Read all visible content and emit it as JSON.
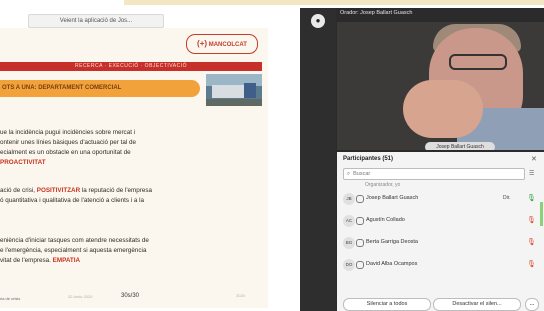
{
  "share_bar": {
    "text": "Veient la aplicació de Jos..."
  },
  "slide": {
    "logo_text": "MANCOLCAT",
    "logo_mark": "(+)",
    "red_band": "RECERCA · EXECUCIÓ · OBJECTIVACIÓ",
    "orange_band": "OTS A  UNA: DEPARTAMENT COMERCIAL",
    "p1": [
      "ue la incidència pugui incidències sobre mercat i",
      "ontenir unes línies bàsiques d'actuació per tal de",
      "ecialment es un obstacle en una oportunitat de"
    ],
    "p1_em": "PROACTIVITAT",
    "p2_a": "ació de crisi, ",
    "p2_em": "POSITIVITZAR",
    "p2_b": " la reputació de l'empresa",
    "p2_line2": "ó quantitativa i qualitativa de l'atenció a clients i a la",
    "p3": [
      "eniència d'iniciar tasques com atendre necessitats de",
      "e l'emergència, especialment si aquesta emergència"
    ],
    "p3_last_a": "vitat de l'empresa. ",
    "p3_em": "EMPATIA",
    "footer_left": "ria de crisis",
    "footer_mid": "32-iunio-2020",
    "footer_num": "30s/30",
    "footer_right": "2020"
  },
  "meeting": {
    "rail_icon": "camera-icon",
    "title": "Orador: Josep Ballart Guasch",
    "name_tag": "Josep Ballart Guasch",
    "participants_header": "Participantes (51)",
    "search_placeholder": "Buscar",
    "sub_label": "Organizador, yo",
    "rows": [
      {
        "initials": "JB",
        "name": "Josep Ballart Guasch",
        "extra": "Dir.",
        "mic": "green"
      },
      {
        "initials": "AC",
        "name": "Agustín Collado",
        "extra": "",
        "mic": "red"
      },
      {
        "initials": "BG",
        "name": "Berta Garriga Deosta",
        "extra": "",
        "mic": "red"
      },
      {
        "initials": "DO",
        "name": "David Alba Ocampos",
        "extra": "",
        "mic": "red"
      }
    ],
    "btn_mute_all": "Silenciar a todos",
    "btn_unmute": "Desactivar el silen...",
    "btn_more": "..."
  },
  "colors": {
    "red": "#c62f2a",
    "orange": "#f2a23a",
    "slide_bg": "#fbf7ee",
    "dark": "#2b2b2b"
  }
}
